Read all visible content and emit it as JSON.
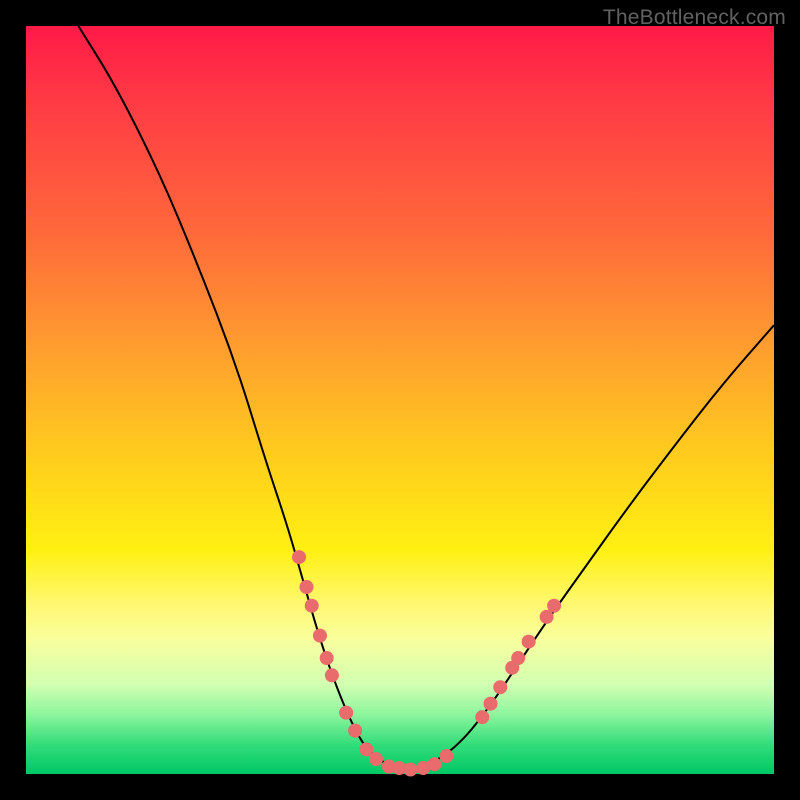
{
  "watermark": "TheBottleneck.com",
  "chart_data": {
    "type": "line",
    "title": "",
    "xlabel": "",
    "ylabel": "",
    "xlim": [
      0,
      100
    ],
    "ylim": [
      0,
      100
    ],
    "grid": false,
    "left_branch": [
      {
        "x": 7,
        "y": 100
      },
      {
        "x": 12,
        "y": 92
      },
      {
        "x": 18,
        "y": 80
      },
      {
        "x": 23,
        "y": 68
      },
      {
        "x": 28,
        "y": 55
      },
      {
        "x": 32,
        "y": 42
      },
      {
        "x": 35,
        "y": 33
      },
      {
        "x": 37,
        "y": 26
      },
      {
        "x": 39,
        "y": 19
      },
      {
        "x": 41,
        "y": 13
      },
      {
        "x": 43,
        "y": 8
      },
      {
        "x": 45,
        "y": 4
      },
      {
        "x": 47,
        "y": 2
      },
      {
        "x": 49,
        "y": 1
      },
      {
        "x": 51,
        "y": 0.5
      }
    ],
    "right_branch": [
      {
        "x": 51,
        "y": 0.5
      },
      {
        "x": 54,
        "y": 1.2
      },
      {
        "x": 58,
        "y": 4
      },
      {
        "x": 62,
        "y": 9
      },
      {
        "x": 66,
        "y": 15
      },
      {
        "x": 70,
        "y": 21
      },
      {
        "x": 75,
        "y": 28
      },
      {
        "x": 80,
        "y": 35
      },
      {
        "x": 86,
        "y": 43
      },
      {
        "x": 93,
        "y": 52
      },
      {
        "x": 100,
        "y": 60
      }
    ],
    "left_markers": [
      {
        "x": 36.5,
        "y": 29
      },
      {
        "x": 37.5,
        "y": 25
      },
      {
        "x": 38.2,
        "y": 22.5
      },
      {
        "x": 39.3,
        "y": 18.5
      },
      {
        "x": 40.2,
        "y": 15.5
      },
      {
        "x": 40.9,
        "y": 13.2
      },
      {
        "x": 42.8,
        "y": 8.2
      },
      {
        "x": 44.0,
        "y": 5.8
      },
      {
        "x": 45.5,
        "y": 3.3
      },
      {
        "x": 46.8,
        "y": 2.0
      },
      {
        "x": 48.5,
        "y": 1.0
      },
      {
        "x": 49.9,
        "y": 0.8
      },
      {
        "x": 51.4,
        "y": 0.6
      },
      {
        "x": 53.1,
        "y": 0.8
      },
      {
        "x": 54.6,
        "y": 1.3
      },
      {
        "x": 56.2,
        "y": 2.4
      }
    ],
    "right_markers": [
      {
        "x": 61.0,
        "y": 7.6
      },
      {
        "x": 62.1,
        "y": 9.4
      },
      {
        "x": 63.4,
        "y": 11.6
      },
      {
        "x": 65.0,
        "y": 14.2
      },
      {
        "x": 65.8,
        "y": 15.5
      },
      {
        "x": 67.2,
        "y": 17.7
      },
      {
        "x": 69.6,
        "y": 21.0
      },
      {
        "x": 70.6,
        "y": 22.5
      }
    ],
    "colors": {
      "curve": "#000000",
      "markers": "#e96b6b",
      "gradient_top": "#ff1a47",
      "gradient_mid": "#ffd21f",
      "gradient_bottom": "#00c765",
      "frame": "#000000"
    }
  }
}
